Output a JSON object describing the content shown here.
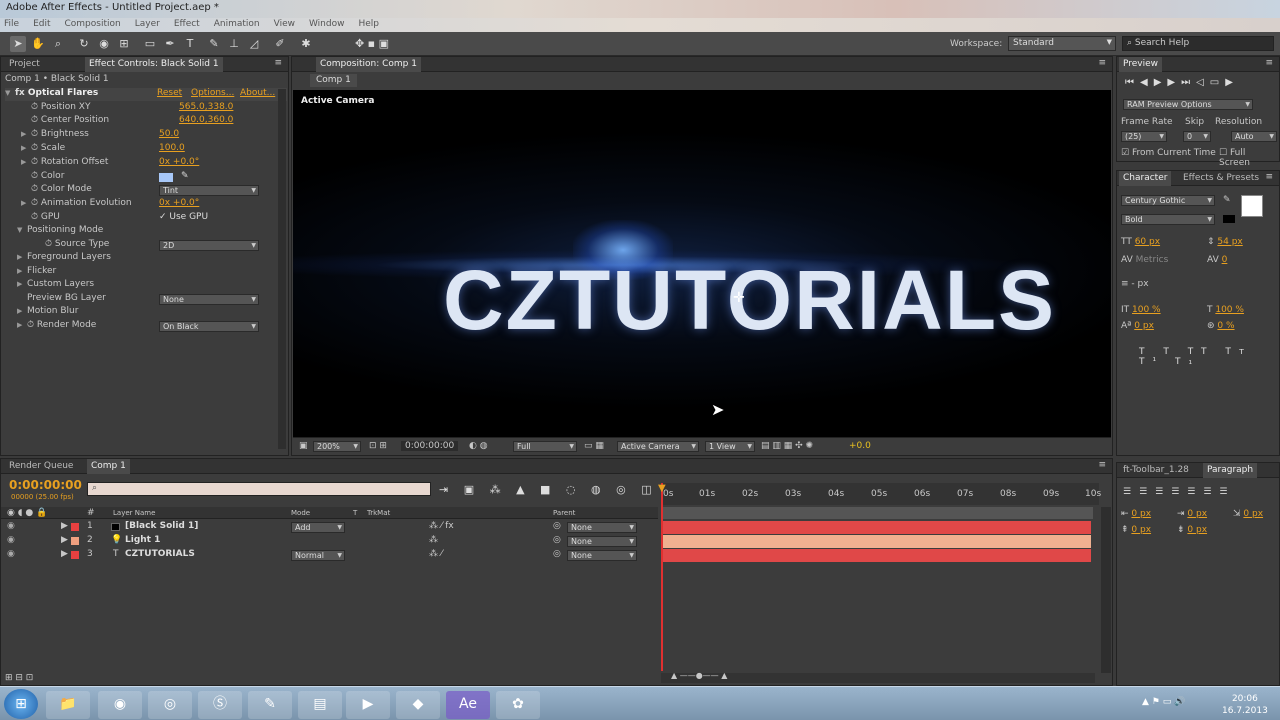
{
  "app": {
    "title": "Adobe After Effects - Untitled Project.aep *",
    "menu": [
      "File",
      "Edit",
      "Composition",
      "Layer",
      "Effect",
      "Animation",
      "View",
      "Window",
      "Help"
    ]
  },
  "toolbar": {
    "workspace_label": "Workspace:",
    "workspace_value": "Standard",
    "search_placeholder": "Search Help"
  },
  "effect_panel": {
    "tab_project": "Project",
    "tab_effect": "Effect Controls: Black Solid 1",
    "breadcrumb": "Comp 1 • Black Solid 1",
    "effect_name": "Optical Flares",
    "reset": "Reset",
    "options": "Options...",
    "about": "About...",
    "props": [
      {
        "label": "Position XY",
        "value": "565.0,338.0"
      },
      {
        "label": "Center Position",
        "value": "640.0,360.0"
      },
      {
        "label": "Brightness",
        "value": "50.0"
      },
      {
        "label": "Scale",
        "value": "100.0"
      },
      {
        "label": "Rotation Offset",
        "value": "0x +0.0°"
      },
      {
        "label": "Color",
        "value": ""
      },
      {
        "label": "Color Mode",
        "value": "Tint"
      },
      {
        "label": "Animation Evolution",
        "value": "0x +0.0°"
      },
      {
        "label": "GPU",
        "value": "✓ Use GPU"
      },
      {
        "label": "Positioning Mode",
        "value": ""
      },
      {
        "label": "Source Type",
        "value": "2D"
      },
      {
        "label": "Foreground Layers",
        "value": ""
      },
      {
        "label": "Flicker",
        "value": ""
      },
      {
        "label": "Custom Layers",
        "value": ""
      },
      {
        "label": "Preview BG Layer",
        "value": "None"
      },
      {
        "label": "Motion Blur",
        "value": ""
      },
      {
        "label": "Render Mode",
        "value": "On Black"
      }
    ]
  },
  "comp": {
    "tab": "Composition: Comp 1",
    "sub_tab": "Comp 1",
    "view_label": "Active Camera",
    "main_text": "CZTUTORIALS",
    "zoom": "200%",
    "timecode": "0:00:00:00",
    "resolution": "Full",
    "camera": "Active Camera",
    "views": "1 View",
    "exposure": "+0.0"
  },
  "preview": {
    "tab": "Preview",
    "ram_options": "RAM Preview Options",
    "frame_rate_label": "Frame Rate",
    "skip_label": "Skip",
    "resolution_label": "Resolution",
    "frame_rate": "(25)",
    "skip": "0",
    "resolution": "Auto",
    "from_current": "From Current Time",
    "full_screen": "Full Screen"
  },
  "character": {
    "tab": "Character",
    "tab2": "Effects & Presets",
    "font": "Century Gothic",
    "style": "Bold",
    "size": "60 px",
    "leading": "54 px",
    "kerning": "Metrics",
    "tracking": "0",
    "stroke": "- px",
    "vscale": "100 %",
    "hscale": "100 %",
    "baseline": "0 px",
    "tsume": "0 %"
  },
  "paragraph": {
    "tab1": "ft-Toolbar_1.28",
    "tab2": "Paragraph",
    "indent1": "0 px",
    "indent2": "0 px",
    "indent3": "0 px",
    "space1": "0 px",
    "space2": "0 px"
  },
  "timeline": {
    "tab_render": "Render Queue",
    "tab_comp": "Comp 1",
    "timecode": "0:00:00:00",
    "frames": "00000 (25.00 fps)",
    "col_name": "Layer Name",
    "col_mode": "Mode",
    "col_t": "T",
    "col_trkmat": "TrkMat",
    "col_parent": "Parent",
    "ruler": [
      "0s",
      "01s",
      "02s",
      "03s",
      "04s",
      "05s",
      "06s",
      "07s",
      "08s",
      "09s",
      "10s"
    ],
    "layers": [
      {
        "num": "1",
        "name": "[Black Solid 1]",
        "mode": "Add",
        "parent": "None",
        "color": "#e84040"
      },
      {
        "num": "2",
        "name": "Light 1",
        "mode": "",
        "parent": "None",
        "color": "#f0a080"
      },
      {
        "num": "3",
        "name": "CZTUTORIALS",
        "mode": "Normal",
        "parent": "None",
        "color": "#e84040"
      }
    ]
  },
  "taskbar": {
    "time": "20:06",
    "date": "16.7.2013"
  }
}
